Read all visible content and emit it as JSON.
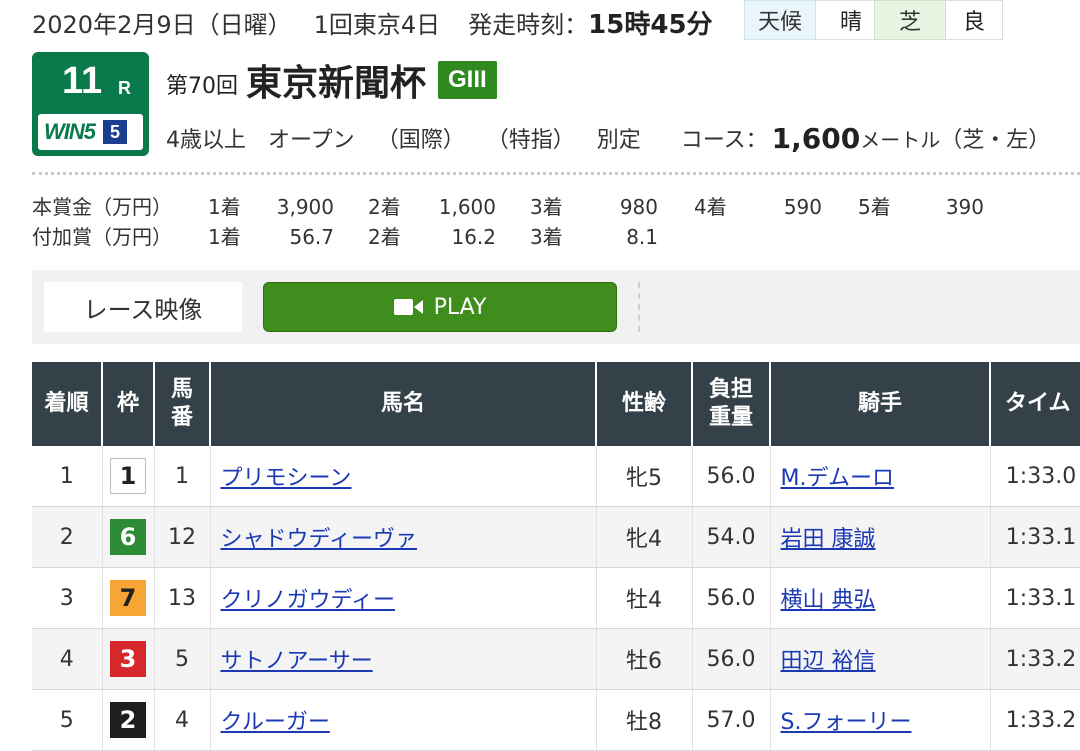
{
  "header": {
    "date": "2020年2月9日（日曜）",
    "meeting": "1回東京4日",
    "post_time_label": "発走時刻：",
    "post_time": "15時45分",
    "weather_label": "天候",
    "weather": "晴",
    "track_label": "芝",
    "track_condition": "良"
  },
  "race": {
    "number": "11",
    "r_suffix": "R",
    "win5_logo": "WIN5",
    "win5_leg": "5",
    "edition": "第70回",
    "name": "東京新聞杯",
    "grade": "GIII",
    "age": "4歳以上",
    "class": "オープン",
    "intl": "（国際）",
    "designation": "（特指）",
    "weight_rule": "別定",
    "course_label": "コース：",
    "distance": "1,600",
    "distance_unit": "メートル",
    "surface": "（芝・左）"
  },
  "prize": {
    "main_label": "本賞金（万円）",
    "bonus_label": "付加賞（万円）",
    "places": [
      "1着",
      "2着",
      "3着",
      "4着",
      "5着"
    ],
    "main": [
      "3,900",
      "1,600",
      "980",
      "590",
      "390"
    ],
    "bonus": [
      "56.7",
      "16.2",
      "8.1"
    ]
  },
  "video": {
    "label": "レース映像",
    "play_label": "PLAY"
  },
  "table": {
    "headers": {
      "rank": "着順",
      "waku": "枠",
      "umaban_1": "馬",
      "umaban_2": "番",
      "horse": "馬名",
      "sex_age": "性齢",
      "weight_1": "負担",
      "weight_2": "重量",
      "jockey": "騎手",
      "time": "タイム"
    },
    "rows": [
      {
        "rank": "1",
        "waku": "1",
        "waku_bg": "#ffffff",
        "waku_fg": "#222222",
        "waku_border": "#bbbbbb",
        "umaban": "1",
        "horse": "プリモシーン",
        "sex_age": "牝5",
        "weight": "56.0",
        "jockey": "M.デムーロ",
        "time": "1:33.0"
      },
      {
        "rank": "2",
        "waku": "6",
        "waku_bg": "#2d8b35",
        "waku_fg": "#ffffff",
        "waku_border": "#2d8b35",
        "umaban": "12",
        "horse": "シャドウディーヴァ",
        "sex_age": "牝4",
        "weight": "54.0",
        "jockey": "岩田 康誠",
        "time": "1:33.1"
      },
      {
        "rank": "3",
        "waku": "7",
        "waku_bg": "#f7a535",
        "waku_fg": "#222222",
        "waku_border": "#f7a535",
        "umaban": "13",
        "horse": "クリノガウディー",
        "sex_age": "牡4",
        "weight": "56.0",
        "jockey": "横山 典弘",
        "time": "1:33.1"
      },
      {
        "rank": "4",
        "waku": "3",
        "waku_bg": "#d6282b",
        "waku_fg": "#ffffff",
        "waku_border": "#d6282b",
        "umaban": "5",
        "horse": "サトノアーサー",
        "sex_age": "牡6",
        "weight": "56.0",
        "jockey": "田辺 裕信",
        "time": "1:33.2"
      },
      {
        "rank": "5",
        "waku": "2",
        "waku_bg": "#1f1f1f",
        "waku_fg": "#ffffff",
        "waku_border": "#1f1f1f",
        "umaban": "4",
        "horse": "クルーガー",
        "sex_age": "牡8",
        "weight": "57.0",
        "jockey": "S.フォーリー",
        "time": "1:33.2"
      }
    ]
  }
}
